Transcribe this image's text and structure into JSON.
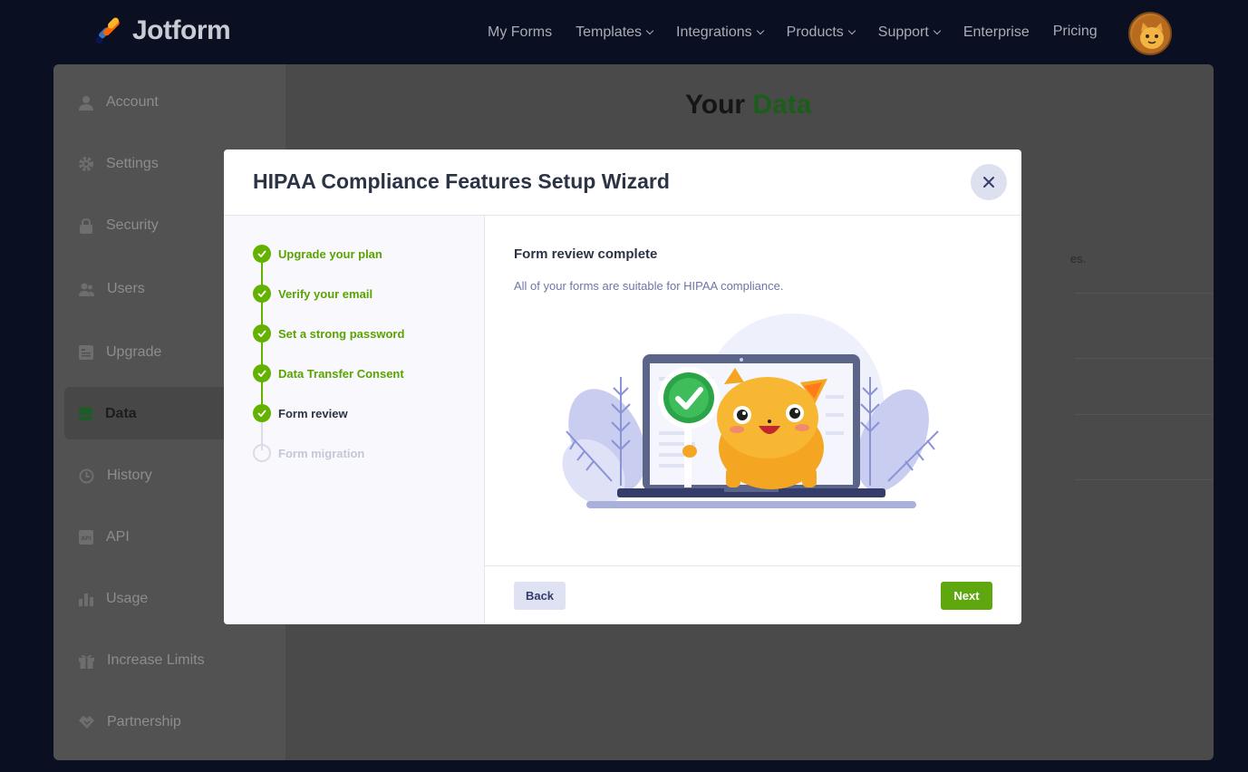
{
  "brand": {
    "name": "Jotform"
  },
  "nav": {
    "items": [
      {
        "label": "My Forms",
        "has_dropdown": false
      },
      {
        "label": "Templates",
        "has_dropdown": true
      },
      {
        "label": "Integrations",
        "has_dropdown": true
      },
      {
        "label": "Products",
        "has_dropdown": true
      },
      {
        "label": "Support",
        "has_dropdown": true
      },
      {
        "label": "Enterprise",
        "has_dropdown": false
      },
      {
        "label": "Pricing",
        "has_dropdown": false
      }
    ]
  },
  "sidebar": {
    "items": [
      {
        "label": "Account",
        "icon": "user-icon"
      },
      {
        "label": "Settings",
        "icon": "gear-icon"
      },
      {
        "label": "Security",
        "icon": "lock-icon"
      },
      {
        "label": "Users",
        "icon": "users-icon"
      },
      {
        "label": "Upgrade",
        "icon": "upgrade-icon"
      },
      {
        "label": "Data",
        "icon": "database-icon",
        "active": true
      },
      {
        "label": "History",
        "icon": "history-icon"
      },
      {
        "label": "API",
        "icon": "api-icon"
      },
      {
        "label": "Usage",
        "icon": "bar-chart-icon"
      },
      {
        "label": "Increase Limits",
        "icon": "gift-icon"
      },
      {
        "label": "Partnership",
        "icon": "handshake-icon"
      }
    ]
  },
  "main": {
    "title_prefix": "Your",
    "title_highlight": "Data",
    "partial_text": "es."
  },
  "modal": {
    "title": "HIPAA Compliance Features Setup Wizard",
    "steps": [
      {
        "label": "Upgrade your plan",
        "status": "done"
      },
      {
        "label": "Verify your email",
        "status": "done"
      },
      {
        "label": "Set a strong password",
        "status": "done"
      },
      {
        "label": "Data Transfer Consent",
        "status": "done"
      },
      {
        "label": "Form review",
        "status": "current"
      },
      {
        "label": "Form migration",
        "status": "pending"
      }
    ],
    "content_title": "Form review complete",
    "content_subtitle": "All of your forms are suitable for HIPAA compliance.",
    "back_label": "Back",
    "next_label": "Next"
  },
  "colors": {
    "accent_green": "#64b200",
    "next_button": "#5fa70f",
    "back_button": "#dfe2f2",
    "nav_bg": "#0a1022"
  }
}
